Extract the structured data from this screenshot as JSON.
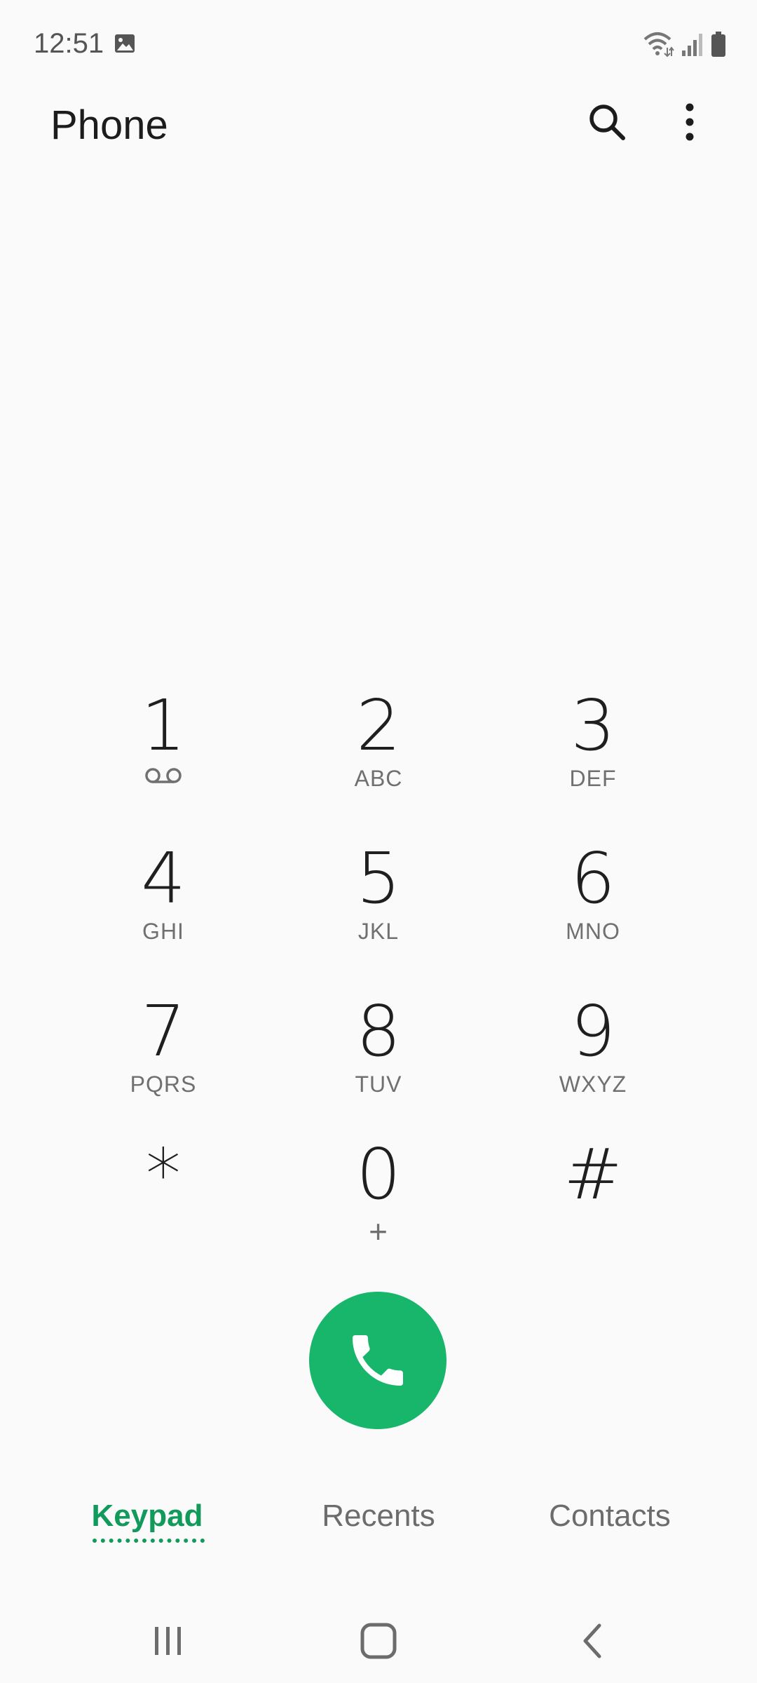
{
  "status_bar": {
    "time": "12:51",
    "icons": [
      "gallery-icon",
      "wifi-icon",
      "signal-icon",
      "battery-icon"
    ]
  },
  "app_bar": {
    "title": "Phone",
    "actions": [
      "search-icon",
      "more-options-icon"
    ]
  },
  "keypad": {
    "keys": [
      {
        "digit": "1",
        "letters": "",
        "icon": "voicemail-icon"
      },
      {
        "digit": "2",
        "letters": "ABC"
      },
      {
        "digit": "3",
        "letters": "DEF"
      },
      {
        "digit": "4",
        "letters": "GHI"
      },
      {
        "digit": "5",
        "letters": "JKL"
      },
      {
        "digit": "6",
        "letters": "MNO"
      },
      {
        "digit": "7",
        "letters": "PQRS"
      },
      {
        "digit": "8",
        "letters": "TUV"
      },
      {
        "digit": "9",
        "letters": "WXYZ"
      },
      {
        "digit": "*",
        "letters": ""
      },
      {
        "digit": "0",
        "letters": "+"
      },
      {
        "digit": "#",
        "letters": ""
      }
    ]
  },
  "call_button": {
    "icon": "phone-icon",
    "color": "#18b66b"
  },
  "tabs": {
    "items": [
      {
        "label": "Keypad",
        "selected": true
      },
      {
        "label": "Recents",
        "selected": false
      },
      {
        "label": "Contacts",
        "selected": false
      }
    ],
    "accent_color": "#119a5c"
  },
  "nav_bar": {
    "buttons": [
      "recent-apps-icon",
      "home-icon",
      "back-icon"
    ]
  }
}
